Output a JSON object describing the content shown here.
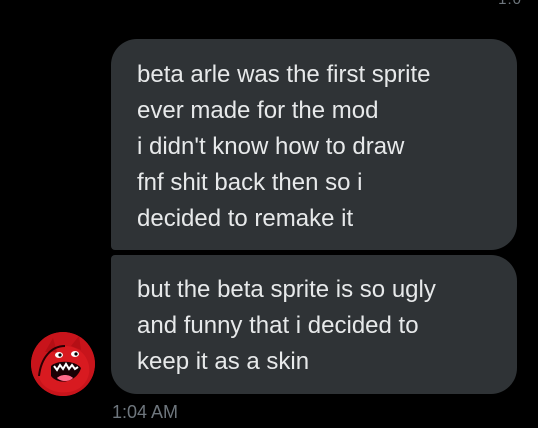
{
  "top_partial_text": "1:0",
  "conversation": {
    "messages": [
      {
        "lines": [
          "beta arle was the first sprite",
          "ever made for the mod",
          "i didn't know how to draw",
          "fnf shit back then so i",
          "decided to remake it"
        ]
      },
      {
        "lines": [
          "but the beta sprite is so ugly",
          "and funny that i decided to",
          "keep it as a skin"
        ]
      }
    ],
    "timestamp": "1:04 AM"
  },
  "avatar": {
    "icon": "red-creature-avatar",
    "color": "#c8141b"
  },
  "colors": {
    "background": "#000000",
    "bubble": "#2f3336",
    "text": "#e7e9ea",
    "muted": "#6e767d"
  }
}
